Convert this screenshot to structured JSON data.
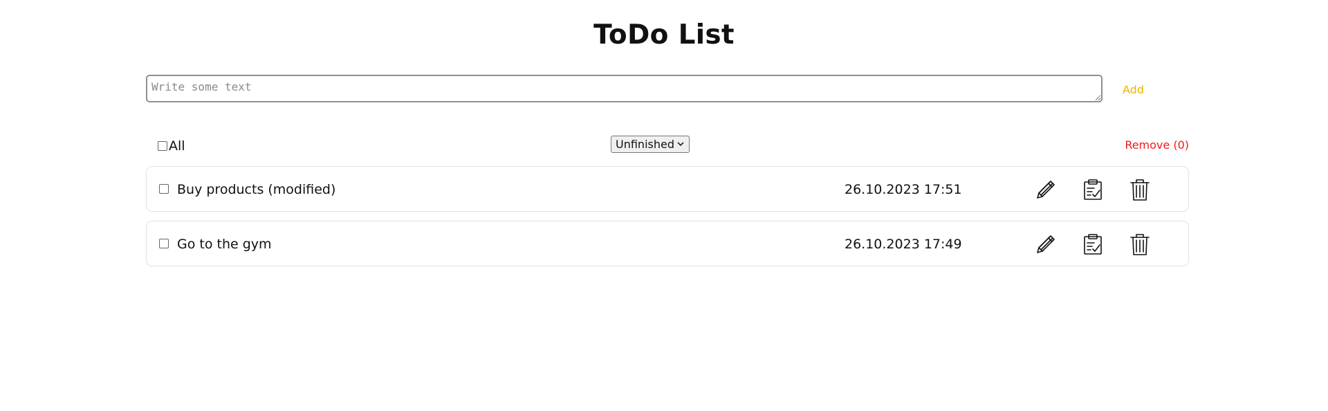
{
  "app": {
    "title": "ToDo List"
  },
  "input": {
    "placeholder": "Write some text",
    "value": ""
  },
  "add_label": "Add",
  "filter": {
    "select_all_label": "All",
    "status_selected": "Unfinished",
    "remove_label": "Remove (0)"
  },
  "todos": [
    {
      "text": "Buy products (modified)",
      "date": "26.10.2023 17:51",
      "checked": false
    },
    {
      "text": "Go to the gym",
      "date": "26.10.2023 17:49",
      "checked": false
    }
  ],
  "icons": {
    "edit": "pencil-icon",
    "done": "clipboard-check-icon",
    "delete": "trash-icon",
    "dropdown": "chevron-down-icon"
  },
  "colors": {
    "add": "#f0b400",
    "remove": "#ee1a1a",
    "item_border": "#e2e2e2"
  }
}
